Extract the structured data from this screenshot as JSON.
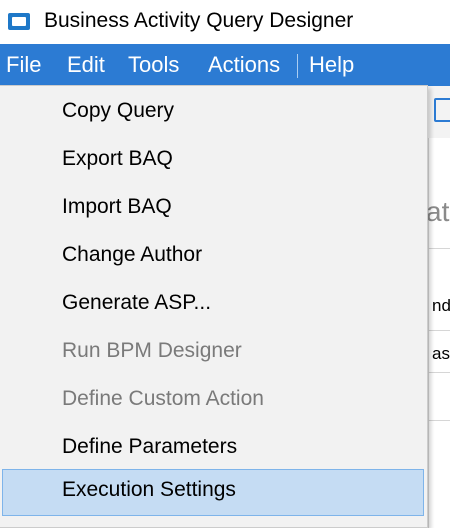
{
  "window": {
    "title": "Business Activity Query Designer",
    "icon": "app-window-icon"
  },
  "menubar": {
    "items": [
      {
        "label": "File"
      },
      {
        "label": "Edit"
      },
      {
        "label": "Tools"
      },
      {
        "label": "Actions"
      },
      {
        "label": "Help"
      }
    ]
  },
  "background": {
    "partial_large": "at",
    "partial_1": "nd",
    "partial_2": "ase"
  },
  "dropdown": {
    "parent_menu": "Actions",
    "items": [
      {
        "label": "Copy Query",
        "enabled": true,
        "highlighted": false
      },
      {
        "label": "Export BAQ",
        "enabled": true,
        "highlighted": false
      },
      {
        "label": "Import BAQ",
        "enabled": true,
        "highlighted": false
      },
      {
        "label": "Change Author",
        "enabled": true,
        "highlighted": false
      },
      {
        "label": "Generate ASP...",
        "enabled": true,
        "highlighted": false
      },
      {
        "label": "Run BPM Designer",
        "enabled": false,
        "highlighted": false
      },
      {
        "label": "Define Custom Action",
        "enabled": false,
        "highlighted": false
      },
      {
        "label": "Define Parameters",
        "enabled": true,
        "highlighted": false
      },
      {
        "label": "Execution Settings",
        "enabled": true,
        "highlighted": true
      }
    ]
  },
  "colors": {
    "menubar_bg": "#2c7bd3",
    "highlight_bg": "#c5dcf3",
    "highlight_border": "#7eb4ea",
    "disabled_text": "#7a7a7a"
  }
}
